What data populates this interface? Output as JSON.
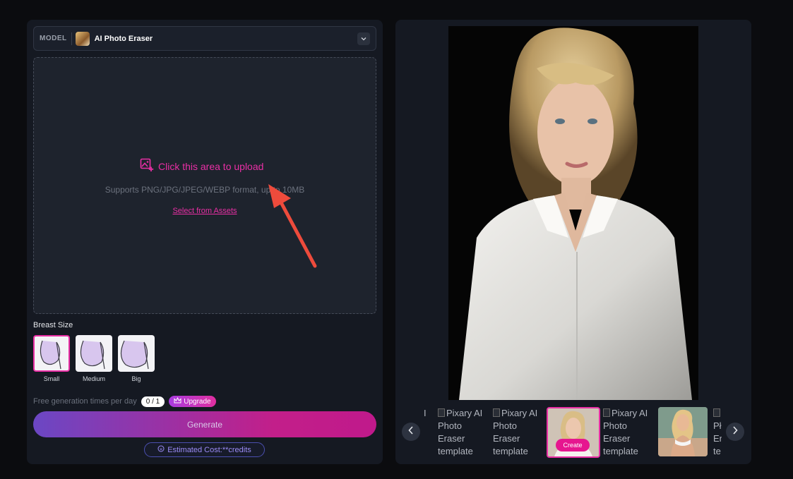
{
  "model": {
    "tag": "MODEL",
    "name": "AI Photo Eraser"
  },
  "upload": {
    "cta": "Click this area to upload",
    "support_text": "Supports PNG/JPG/JPEG/WEBP format, up to 10MB",
    "assets_link": "Select from Assets"
  },
  "breast_size": {
    "label": "Breast Size",
    "options": [
      "Small",
      "Medium",
      "Big"
    ],
    "selected": "Small"
  },
  "free_generation": {
    "label": "Free generation times per day",
    "count": "0 / 1",
    "upgrade_label": "Upgrade"
  },
  "generate_label": "Generate",
  "cost_label": "Estimated Cost:**credits",
  "carousel": {
    "partial_left": "I",
    "items": [
      {
        "kind": "broken",
        "alt": "Pixary AI Photo Eraser template"
      },
      {
        "kind": "broken",
        "alt": "Pixary AI Photo Eraser template"
      },
      {
        "kind": "active",
        "button": "Create"
      },
      {
        "kind": "broken",
        "alt": "Pixary AI Photo Eraser template"
      },
      {
        "kind": "photo"
      }
    ],
    "partial_right": "Pł Er te"
  },
  "colors": {
    "accent": "#e92fa5",
    "background": "#0b0c0f",
    "panel": "#151922"
  },
  "icons": {
    "model_chevron": "chevron-down-icon",
    "upload": "image-upload-icon",
    "upgrade": "crown-icon",
    "cost": "coin-icon",
    "prev": "chevron-left-icon",
    "next": "chevron-right-icon"
  }
}
